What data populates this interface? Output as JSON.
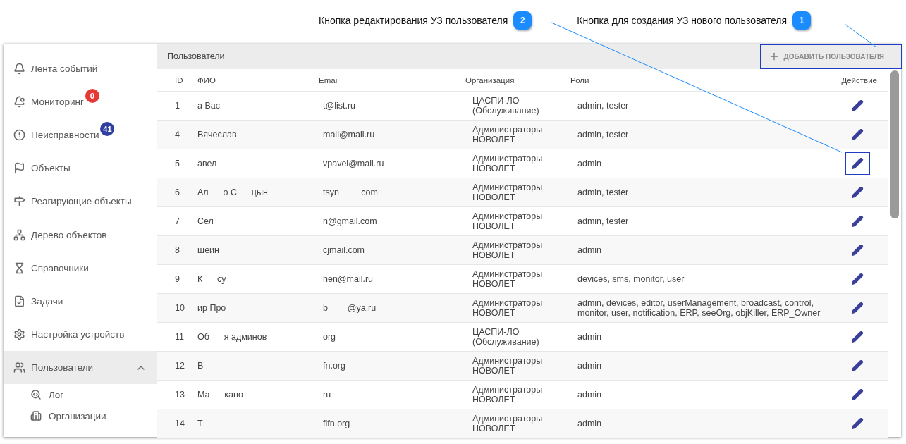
{
  "callouts": [
    {
      "number": "2",
      "text": "Кнопка редактирования УЗ пользователя"
    },
    {
      "number": "1",
      "text": "Кнопка для создания УЗ нового пользователя"
    }
  ],
  "sidebar": {
    "groups": [
      {
        "items": [
          {
            "label": "Лента событий",
            "selected": false
          },
          {
            "label": "Мониторинг",
            "badge": "0",
            "color": "#e53935",
            "selected": false
          },
          {
            "label": "Неисправности",
            "badge": "41",
            "color": "#303f9f",
            "selected": false
          },
          {
            "label": "Объекты",
            "selected": false
          },
          {
            "label": "Реагирующие объекты",
            "selected": false
          }
        ]
      },
      {
        "items": [
          {
            "label": "Дерево объектов",
            "selected": false
          },
          {
            "label": "Справочники",
            "selected": false
          },
          {
            "label": "Задачи",
            "selected": false
          },
          {
            "label": "Настройка устройств",
            "selected": false
          },
          {
            "label": "Пользователи",
            "selected": true,
            "expanded": true,
            "children": [
              {
                "label": "Лог"
              },
              {
                "label": "Организации"
              }
            ]
          }
        ]
      }
    ]
  },
  "panel": {
    "title": "Пользователи",
    "add_button": {
      "label": "ДОБАВИТЬ ПОЛЬЗОВАТЕЛЯ",
      "highlighted": true
    }
  },
  "table": {
    "columns": [
      "ID",
      "ФИО",
      "Email",
      "Организация",
      "Роли",
      "Действие"
    ],
    "rows": [
      {
        "cells": [
          "1",
          "а Вас",
          "t@list.ru",
          "ЦАСПИ-ЛО\n(Обслуживание)",
          "admin, tester"
        ],
        "highlighted": false
      },
      {
        "cells": [
          "4",
          "Вячеслав",
          "mail@mail.ru",
          "Администраторы\nНОВОЛЕТ",
          "admin, tester"
        ],
        "highlighted": false
      },
      {
        "cells": [
          "5",
          "авел",
          "vpavel@mail.ru",
          "Администраторы\nНОВОЛЕТ",
          "admin"
        ],
        "highlighted": true
      },
      {
        "cells": [
          "6",
          "Ал      о С      цын",
          "tsyn         com",
          "Администраторы\nНОВОЛЕТ",
          "admin, tester"
        ],
        "highlighted": false
      },
      {
        "cells": [
          "7",
          "Сел",
          "n@gmail.com",
          "Администраторы\nНОВОЛЕТ",
          "admin, tester"
        ],
        "highlighted": false
      },
      {
        "cells": [
          "8",
          "щеин",
          "cjmail.com",
          "Администраторы\nНОВОЛЕТ",
          "admin"
        ],
        "highlighted": false
      },
      {
        "cells": [
          "9",
          "К      су",
          "hen@mail.ru",
          "Администраторы\nНОВОЛЕТ",
          "devices, sms, monitor, user"
        ],
        "highlighted": false
      },
      {
        "cells": [
          "10",
          "ир Про",
          "b        @ya.ru",
          "Администраторы\nНОВОЛЕТ",
          "admin, devices, editor, userManagement, broadcast, control, monitor, user, notification, ERP, seeOrg, objKiller, ERP_Owner"
        ],
        "highlighted": false
      },
      {
        "cells": [
          "11",
          "Об      я админов",
          "org",
          "ЦАСПИ-ЛО\n(Обслуживание)",
          "admin"
        ],
        "highlighted": false
      },
      {
        "cells": [
          "12",
          "В",
          "fn.org",
          "Администраторы\nНОВОЛЕТ",
          "admin"
        ],
        "highlighted": false
      },
      {
        "cells": [
          "13",
          "Ма      кано",
          "ru",
          "Администраторы\nНОВОЛЕТ",
          "admin"
        ],
        "highlighted": false
      },
      {
        "cells": [
          "14",
          "Т",
          "fifn.org",
          "Администраторы\nНОВОЛЕТ",
          "admin"
        ],
        "highlighted": false
      }
    ]
  }
}
